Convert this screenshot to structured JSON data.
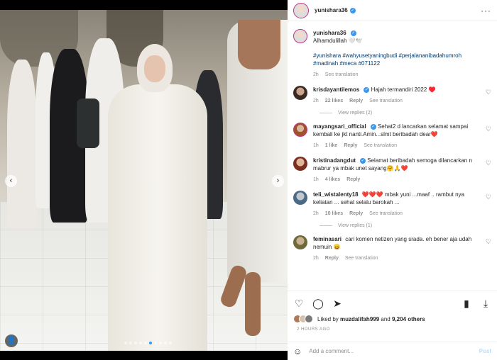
{
  "post": {
    "username": "yunishara36",
    "caption_text": "Alhamdulillah 🤍🕊️",
    "hashtags": "#yunishara #wahyusetyaningbudi #perjalananibadahumroh #madinah #meca #071122",
    "caption_time": "2h",
    "caption_see_translation": "See translation"
  },
  "comments": [
    {
      "user": "krisdayantilemos",
      "text": "Hajah termandiri 2022 ♥️",
      "time": "2h",
      "likes": "22 likes",
      "reply": "Reply",
      "translate": "See translation",
      "view_replies": "View replies (2)"
    },
    {
      "user": "mayangsari_official",
      "text": "Sehat2 d lancarkan selamat sampai kembali ke jkt nanti.Amin...slmt beribadah dear❤️",
      "time": "1h",
      "likes": "1 like",
      "reply": "Reply",
      "translate": "See translation"
    },
    {
      "user": "kristinadangdut",
      "text": "Selamat beribadah semoga dilancarkan n mabrur ya mbak unet sayang🤗🙏❤️",
      "time": "1h",
      "likes": "4 likes",
      "reply": "Reply"
    },
    {
      "user": "teli_wistalenty18",
      "text": "❤️❤️❤️ mbak yuni ...maaf .. rambut nya keliatan ... sehat selalu barokah ...",
      "time": "2h",
      "likes": "10 likes",
      "reply": "Reply",
      "translate": "See translation",
      "view_replies": "View replies (1)"
    },
    {
      "user": "feminasari",
      "text": "cari komen netizen yang srada. eh bener aja udah nemuin 😄",
      "time": "2h",
      "reply": "Reply",
      "translate": "See translation"
    }
  ],
  "likes": {
    "prefix": "Liked by",
    "user": "muzdalifah999",
    "and": "and",
    "others": "9,204 others"
  },
  "date": "2 HOURS AGO",
  "add_comment": {
    "placeholder": "Add a comment...",
    "post_label": "Post"
  },
  "icons": {
    "more": "more-dots-icon",
    "heart": "heart-icon",
    "comment": "comment-icon",
    "share": "share-icon",
    "save": "bookmark-icon",
    "download": "download-icon",
    "emoji": "emoji-icon"
  },
  "colors": {
    "link": "#00376b",
    "verified": "#3897f0",
    "muted": "#8e8e8e"
  }
}
